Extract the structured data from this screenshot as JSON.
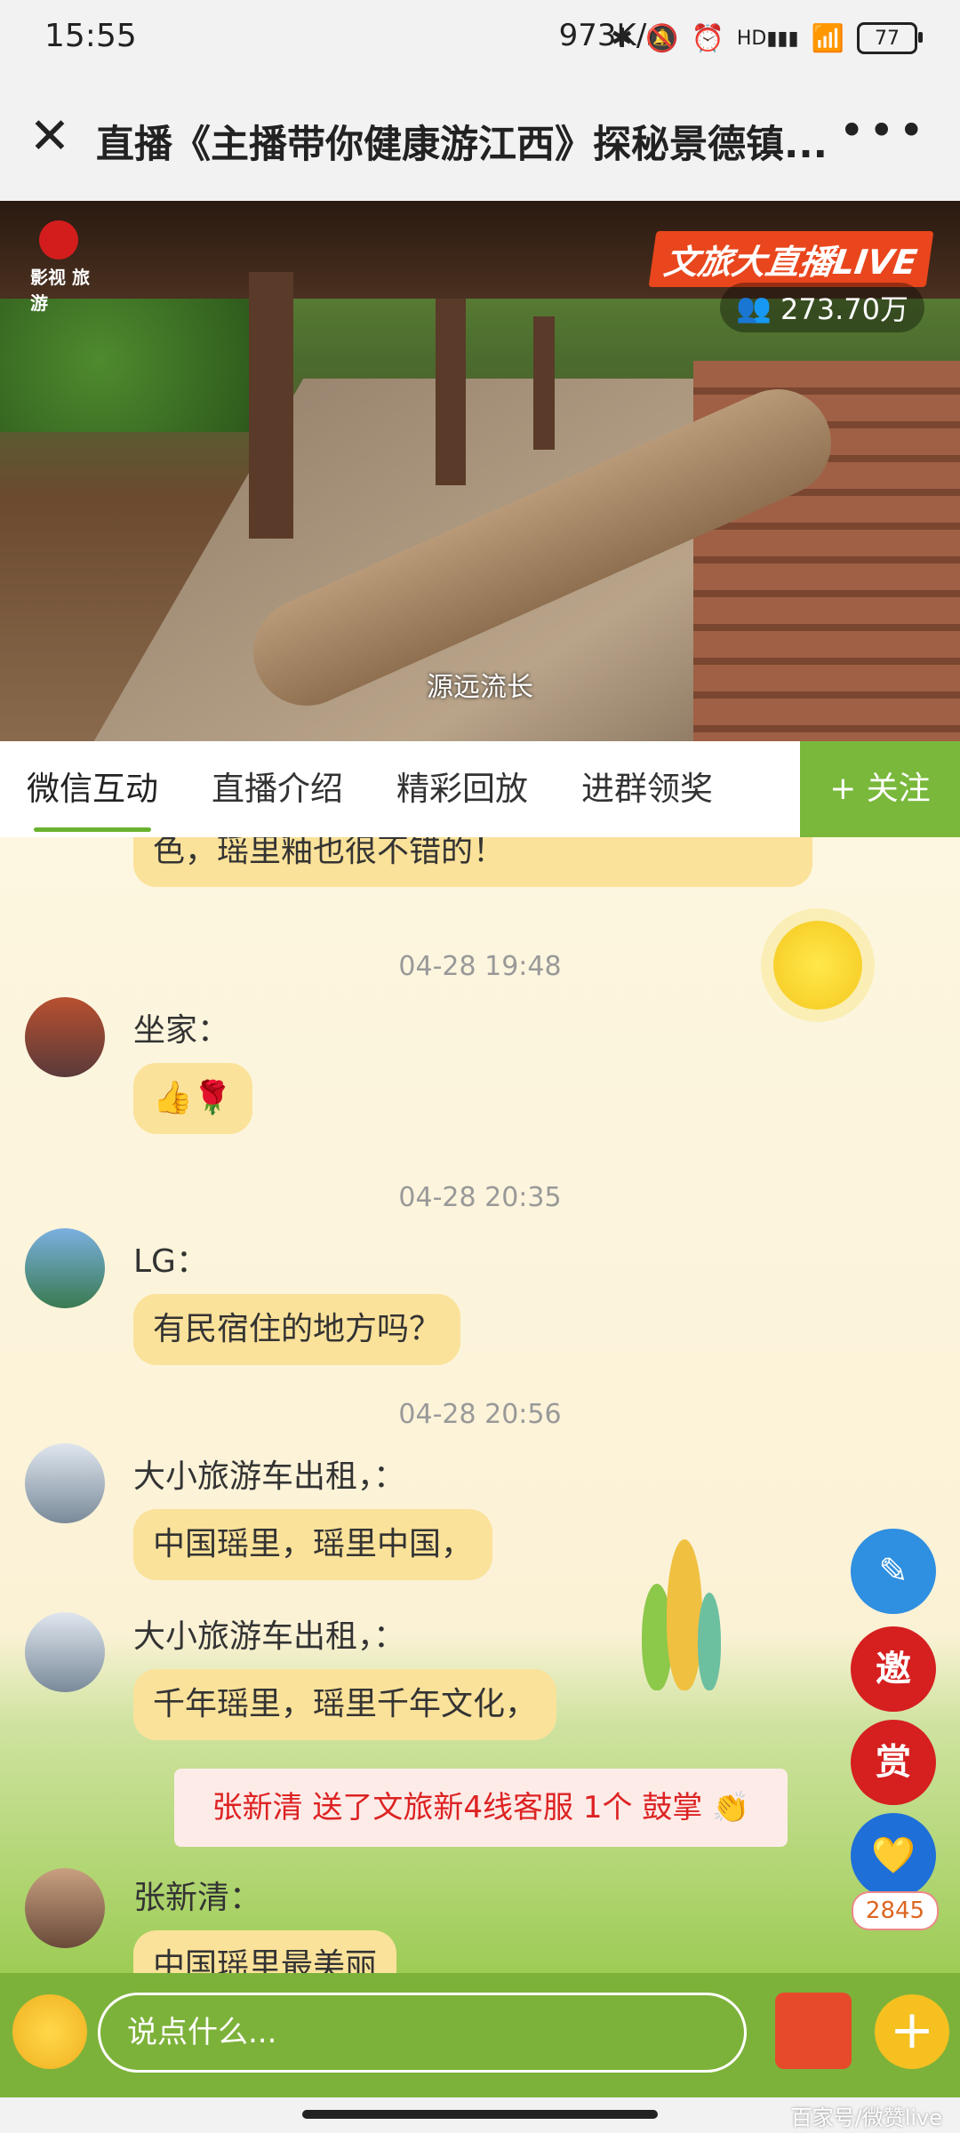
{
  "status": {
    "time": "15:55",
    "network": "973K/s",
    "battery": "77",
    "hd": "HD"
  },
  "header": {
    "title": "直播《主播带你健康游江西》探秘景德镇...",
    "close": "✕",
    "more": "•••"
  },
  "video": {
    "logo_text": "影视 旅游",
    "brand": "文旅大直播LIVE",
    "viewers": "273.70万",
    "subtitle": "源远流长"
  },
  "tabs": [
    "微信互动",
    "直播介绍",
    "精彩回放",
    "进群领奖"
  ],
  "follow_label": "+ 关注",
  "chat": {
    "partial_message": "色，瑶里釉也很不错的！",
    "messages": [
      {
        "timestamp": "04-28 19:48",
        "user": "坐家：",
        "text": "👍🌹"
      },
      {
        "timestamp": "04-28 20:35",
        "user": "LG：",
        "text": "有民宿住的地方吗？"
      },
      {
        "timestamp": "04-28 20:56",
        "user": "大小旅游车出租，：",
        "text": "中国瑶里，瑶里中国，"
      },
      {
        "user": "大小旅游车出租，：",
        "text": "千年瑶里，瑶里千年文化，"
      },
      {
        "user": "张新清：",
        "text": "中国瑶里最美丽"
      }
    ],
    "gift_banner": "张新清 送了文旅新4线客服 1个 鼓掌 👏"
  },
  "fabs": {
    "invite": "邀",
    "reward": "赏",
    "like_count": "2845"
  },
  "input": {
    "placeholder": "说点什么..."
  },
  "watermark": "百家号/微赞live",
  "colors": {
    "accent": "#79b83b",
    "bubble": "#fbe29a",
    "gift_text": "#d22222"
  }
}
